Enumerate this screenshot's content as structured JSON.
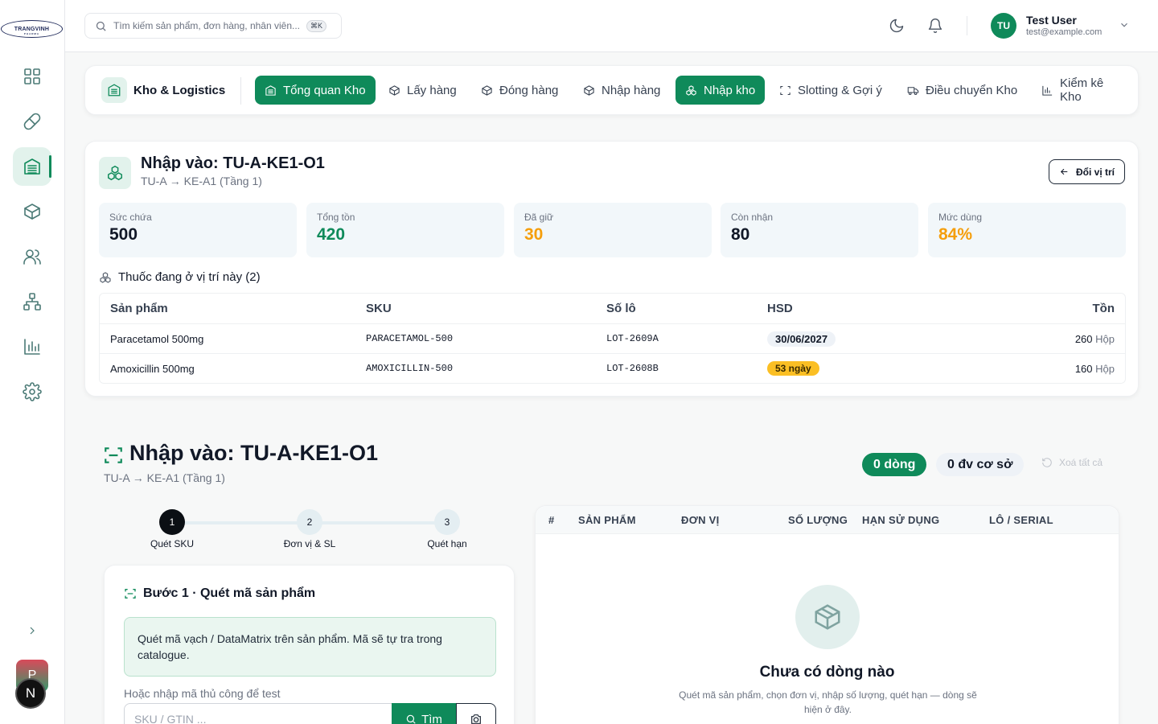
{
  "brand": {
    "logo_text": "TRANGVINH",
    "logo_sub": "PHARMA"
  },
  "sidebar": {
    "items": [
      {
        "name": "dashboard-icon"
      },
      {
        "name": "pill-icon"
      },
      {
        "name": "warehouse-icon",
        "active": true
      },
      {
        "name": "box-icon"
      },
      {
        "name": "users-icon"
      },
      {
        "name": "network-icon"
      },
      {
        "name": "chart-icon"
      },
      {
        "name": "gear-icon"
      }
    ],
    "avatar_p": "P",
    "avatar_n": "N"
  },
  "topbar": {
    "search_placeholder": "Tìm kiếm sản phẩm, đơn hàng, nhân viên...",
    "shortcut": "⌘K",
    "user_initials": "TU",
    "user_name": "Test User",
    "user_email": "test@example.com"
  },
  "module": {
    "title": "Kho & Logistics",
    "tabs": [
      {
        "label": "Tổng quan Kho",
        "active": true
      },
      {
        "label": "Lấy hàng",
        "active": false
      },
      {
        "label": "Đóng hàng",
        "active": false
      },
      {
        "label": "Nhập hàng",
        "active": false
      },
      {
        "label": "Nhập kho",
        "active": true
      },
      {
        "label": "Slotting & Gợi ý",
        "active": false
      },
      {
        "label": "Điều chuyển Kho",
        "active": false
      },
      {
        "label": "Kiểm kê Kho",
        "active": false
      }
    ]
  },
  "location": {
    "title": "Nhập vào: TU-A-KE1-O1",
    "path": "TU-A → KE-A1 (Tầng 1)",
    "change_label": "Đổi vị trí",
    "stats": [
      {
        "label": "Sức chứa",
        "value": "500",
        "color": "#111827"
      },
      {
        "label": "Tổng tồn",
        "value": "420",
        "color": "#0f8a5a"
      },
      {
        "label": "Đã giữ",
        "value": "30",
        "color": "#f59e0b"
      },
      {
        "label": "Còn nhận",
        "value": "80",
        "color": "#111827"
      },
      {
        "label": "Mức dùng",
        "value": "84%",
        "color": "#f59e0b"
      }
    ],
    "items_title": "Thuốc đang ở vị trí này (2)",
    "columns": [
      "Sản phẩm",
      "SKU",
      "Số lô",
      "HSD",
      "Tồn"
    ],
    "rows": [
      {
        "product": "Paracetamol 500mg",
        "sku": "PARACETAMOL-500",
        "lot": "LOT-2609A",
        "expiry": "30/06/2027",
        "qty": "260",
        "unit": "Hộp"
      },
      {
        "product": "Amoxicillin 500mg",
        "sku": "AMOXICILLIN-500",
        "lot": "LOT-2608B",
        "expiry": "53 ngày",
        "qty": "160",
        "unit": "Hộp"
      }
    ]
  },
  "scan": {
    "title": "Nhập vào: TU-A-KE1-O1",
    "path": "TU-A → KE-A1 (Tầng 1)",
    "lines_count": "0 dòng",
    "base_units": "0 đv cơ sở",
    "clear_all": "Xoá tất cả",
    "steps": [
      {
        "num": "1",
        "label": "Quét SKU"
      },
      {
        "num": "2",
        "label": "Đơn vị & SL"
      },
      {
        "num": "3",
        "label": "Quét hạn"
      }
    ],
    "step_title": "Bước 1 · Quét mã sản phẩm",
    "info": "Quét mã vạch / DataMatrix trên sản phẩm. Mã sẽ tự tra trong catalogue.",
    "manual_label": "Hoặc nhập mã thủ công để test",
    "input_placeholder": "SKU / GTIN ...",
    "find_label": "Tìm",
    "columns": [
      "#",
      "SẢN PHẨM",
      "ĐƠN VỊ",
      "SỐ LƯỢNG",
      "HẠN SỬ DỤNG",
      "LÔ / SERIAL"
    ],
    "empty_title": "Chưa có dòng nào",
    "empty_desc": "Quét mã sản phẩm, chọn đơn vị, nhập số lượng, quét hạn — dòng sẽ hiện ở đây."
  }
}
